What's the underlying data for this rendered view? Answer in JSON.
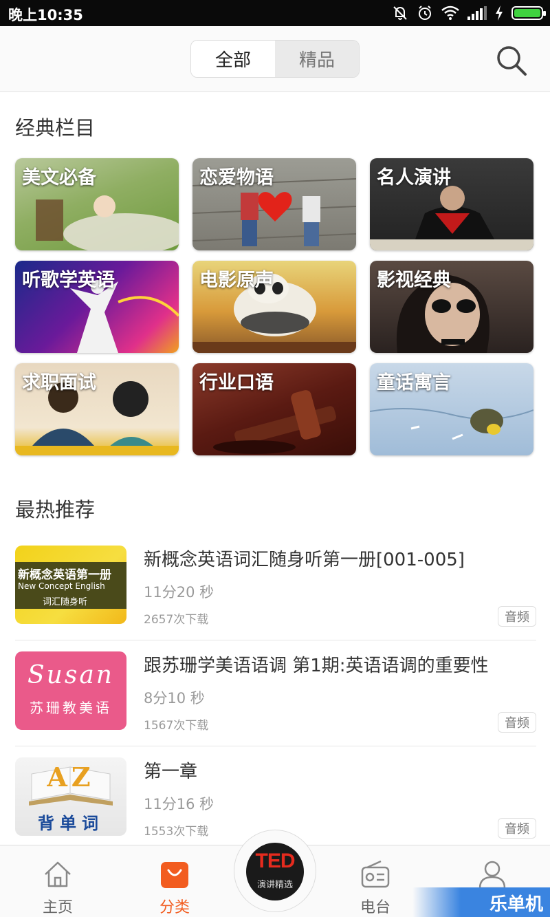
{
  "status_bar": {
    "time": "晚上10:35"
  },
  "top_bar": {
    "segments": [
      {
        "label": "全部",
        "active": true
      },
      {
        "label": "精品",
        "active": false
      }
    ]
  },
  "classic": {
    "title": "经典栏目",
    "tiles": [
      {
        "label": "美文必备"
      },
      {
        "label": "恋爱物语"
      },
      {
        "label": "名人演讲"
      },
      {
        "label": "听歌学英语"
      },
      {
        "label": "电影原声"
      },
      {
        "label": "影视经典"
      },
      {
        "label": "求职面试"
      },
      {
        "label": "行业口语"
      },
      {
        "label": "童话寓言"
      }
    ]
  },
  "hot": {
    "title": "最热推荐",
    "items": [
      {
        "title": "新概念英语词汇随身听第一册[001-005]",
        "duration": "11分20 秒",
        "downloads": "2657次下载",
        "badge": "音频",
        "thumb_lines": [
          "新概念英语第一册",
          "New Concept English",
          "词汇随身听"
        ]
      },
      {
        "title": "跟苏珊学美语语调 第1期:英语语调的重要性",
        "duration": "8分10 秒",
        "downloads": "1567次下载",
        "badge": "音频",
        "thumb_lines": [
          "Susan",
          "苏珊教美语"
        ]
      },
      {
        "title": "第一章",
        "duration": "11分16 秒",
        "downloads": "1553次下载",
        "badge": "音频",
        "thumb_lines": [
          "AZ",
          "背单词"
        ]
      }
    ]
  },
  "bottom_nav": {
    "items": [
      {
        "label": "主页",
        "icon": "home-icon",
        "active": false
      },
      {
        "label": "分类",
        "icon": "bag-icon",
        "active": true
      },
      {
        "label": "电台",
        "icon": "radio-icon",
        "active": false
      },
      {
        "label": "",
        "icon": "person-icon",
        "active": false
      }
    ],
    "center": {
      "logo": "TED",
      "sub": "演讲精选"
    }
  },
  "watermark": "乐单机",
  "colors": {
    "accent": "#f25c1f",
    "battery": "#3fd23f"
  }
}
